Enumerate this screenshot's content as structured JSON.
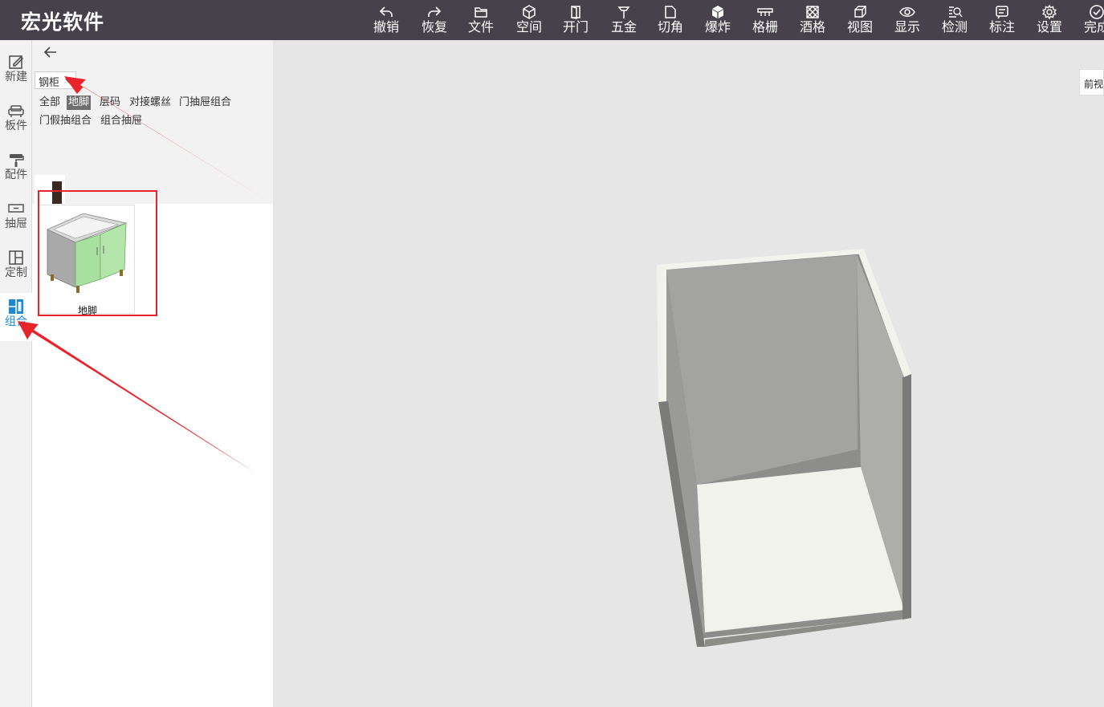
{
  "app": {
    "title": "宏光软件"
  },
  "toolbar": [
    {
      "key": "undo",
      "label": "撤销",
      "icon": "undo-icon"
    },
    {
      "key": "redo",
      "label": "恢复",
      "icon": "redo-icon"
    },
    {
      "key": "file",
      "label": "文件",
      "icon": "folder-icon"
    },
    {
      "key": "space",
      "label": "空间",
      "icon": "cube-outline-icon"
    },
    {
      "key": "door",
      "label": "开门",
      "icon": "door-icon"
    },
    {
      "key": "hardware",
      "label": "五金",
      "icon": "hardware-icon"
    },
    {
      "key": "chamfer",
      "label": "切角",
      "icon": "chamfer-icon"
    },
    {
      "key": "explode",
      "label": "爆炸",
      "icon": "cube-solid-icon"
    },
    {
      "key": "grille",
      "label": "格栅",
      "icon": "grille-icon"
    },
    {
      "key": "winerack",
      "label": "酒格",
      "icon": "wine-rack-icon"
    },
    {
      "key": "view",
      "label": "视图",
      "icon": "view-cube-icon"
    },
    {
      "key": "display",
      "label": "显示",
      "icon": "eye-icon"
    },
    {
      "key": "check",
      "label": "检测",
      "icon": "inspect-icon"
    },
    {
      "key": "annotate",
      "label": "标注",
      "icon": "annotate-icon"
    },
    {
      "key": "settings",
      "label": "设置",
      "icon": "gear-icon"
    },
    {
      "key": "done",
      "label": "完成",
      "icon": "check-circle-icon"
    }
  ],
  "leftnav": [
    {
      "key": "new",
      "label": "新建",
      "icon": "edit-icon"
    },
    {
      "key": "board",
      "label": "板件",
      "icon": "sofa-icon"
    },
    {
      "key": "parts",
      "label": "配件",
      "icon": "roller-icon"
    },
    {
      "key": "drawer",
      "label": "抽屉",
      "icon": "drawer-icon"
    },
    {
      "key": "custom",
      "label": "定制",
      "icon": "layout-icon"
    },
    {
      "key": "combo",
      "label": "组合",
      "icon": "combo-icon",
      "active": true
    }
  ],
  "panel": {
    "category_select": "钢柜",
    "categories_row1": [
      "全部",
      "地脚",
      "层码",
      "对接螺丝",
      "门抽屉组合"
    ],
    "categories_row2": [
      "门假抽组合",
      "组合抽屉"
    ],
    "active_category": "地脚",
    "items": [
      {
        "label": "地脚"
      }
    ]
  },
  "viewport": {
    "view_button": "前视"
  },
  "colors": {
    "topbar": "#46414b",
    "accent": "#1e88d8",
    "highlight": "#e8242a",
    "cabinet_door": "#a8e0a0"
  }
}
